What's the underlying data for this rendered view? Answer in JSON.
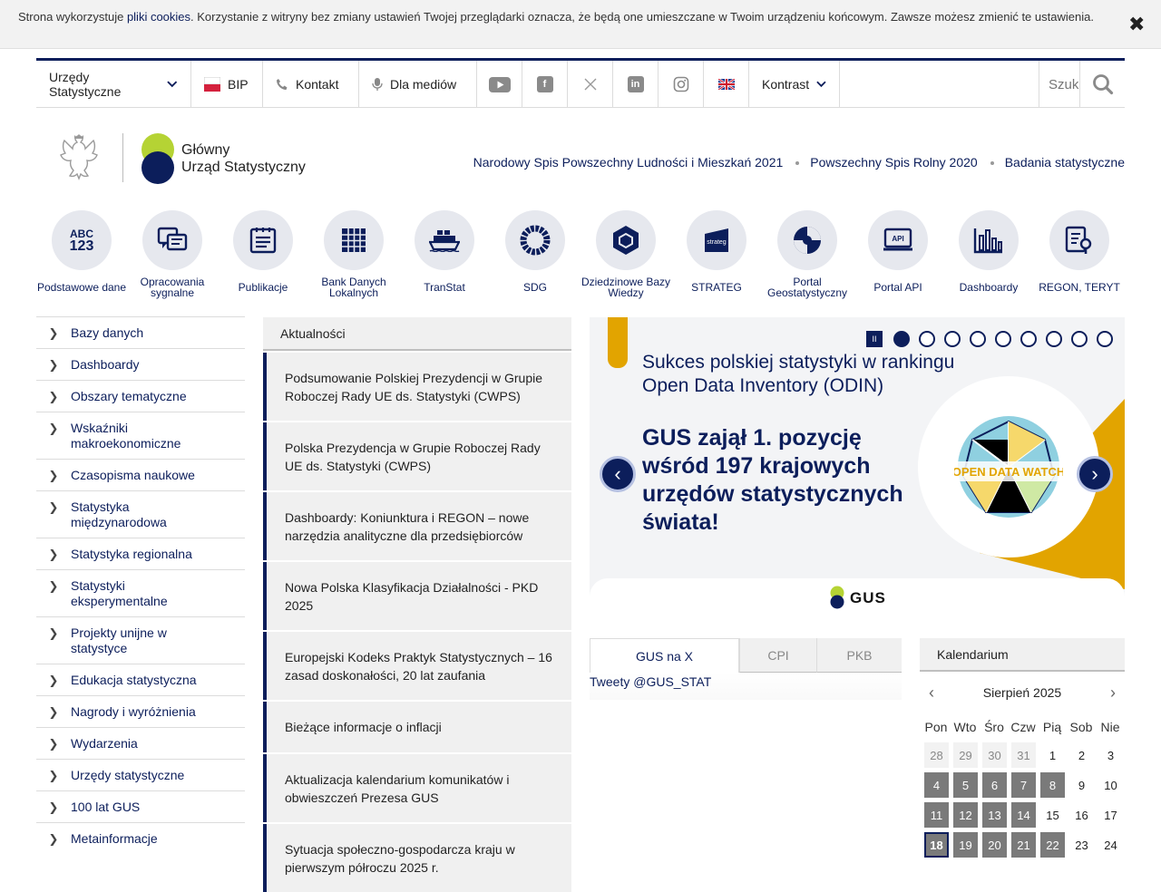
{
  "cookie": {
    "text_before": "Strona wykorzystuje ",
    "link": "pliki cookies",
    "text_after": ". Korzystanie z witryny bez zmiany ustawień Twojej przeglądarki oznacza, że będą one umieszczane w Twoim urządzeniu końcowym. Zawsze możesz zmienić te ustawienia.",
    "close": "✖"
  },
  "topbar": {
    "offices": "Urzędy Statystyczne",
    "bip": "BIP",
    "contact": "Kontakt",
    "media": "Dla mediów",
    "contrast": "Kontrast",
    "search_placeholder": "Szukaj",
    "social_icons": [
      "youtube-icon",
      "facebook-icon",
      "x-icon",
      "linkedin-icon",
      "instagram-icon",
      "uk-flag-icon"
    ]
  },
  "logo": {
    "line1": "Główny",
    "line2": "Urząd Statystyczny"
  },
  "header_links": [
    "Narodowy Spis Powszechny Ludności i Mieszkań 2021",
    "Powszechny Spis Rolny 2020",
    "Badania statystyczne"
  ],
  "tiles": [
    {
      "label": "Podstawowe dane",
      "icon": "abc-123-icon",
      "icon_text": "ABC"
    },
    {
      "label": "Opracowania sygnalne",
      "icon": "document-chat-icon"
    },
    {
      "label": "Publikacje",
      "icon": "publication-icon"
    },
    {
      "label": "Bank Danych Lokalnych",
      "icon": "grid-icon"
    },
    {
      "label": "TranStat",
      "icon": "ship-icon"
    },
    {
      "label": "SDG",
      "icon": "sdg-ring-icon"
    },
    {
      "label": "Dziedzinowe Bazy Wiedzy",
      "icon": "cube-icon"
    },
    {
      "label": "STRATEG",
      "icon": "strateg-icon",
      "icon_text": "strateg"
    },
    {
      "label": "Portal Geostatystyczny",
      "icon": "geo-icon"
    },
    {
      "label": "Portal API",
      "icon": "api-icon",
      "icon_text": "API"
    },
    {
      "label": "Dashboardy",
      "icon": "bar-chart-icon"
    },
    {
      "label": "REGON, TERYT",
      "icon": "search-document-icon"
    }
  ],
  "tile_123": "123",
  "sidebar": [
    "Bazy danych",
    "Dashboardy",
    "Obszary tematyczne",
    "Wskaźniki makroekonomiczne",
    "Czasopisma naukowe",
    "Statystyka międzynarodowa",
    "Statystyka regionalna",
    "Statystyki eksperymentalne",
    "Projekty unijne w statystyce",
    "Edukacja statystyczna",
    "Nagrody i wyróżnienia",
    "Wydarzenia",
    "Urzędy statystyczne",
    "100 lat GUS",
    "Metainformacje"
  ],
  "news": {
    "header": "Aktualności",
    "items": [
      "Podsumowanie Polskiej Prezydencji w Grupie Roboczej Rady UE ds. Statystyki (CWPS)",
      "Polska Prezydencja w Grupie Roboczej Rady UE ds. Statystyki (CWPS)",
      "Dashboardy: Koniunktura i REGON – nowe narzędzia analityczne dla przedsiębiorców",
      "Nowa Polska Klasyfikacja Działalności - PKD 2025",
      "Europejski Kodeks Praktyk Statystycznych – 16 zasad doskonałości, 20 lat zaufania",
      "Bieżące informacje o inflacji",
      "Aktualizacja kalendarium komunikatów i obwieszczeń Prezesa GUS",
      "Sytuacja społeczno-gospodarcza kraju w pierwszym półroczu 2025 r."
    ]
  },
  "slider": {
    "pause": "II",
    "slide_count": 9,
    "active_slide": 1,
    "title": "Sukces polskiej statystyki w rankingu Open Data Inventory (ODIN)",
    "headline": "GUS zajął 1. pozycję wśród 197 krajowych urzędów statystycznych świata!",
    "badge": "OPEN DATA WATCH",
    "footer_logo": "GUS",
    "prev": "‹",
    "next": "›",
    "accent": "#e2a400"
  },
  "tabs": {
    "items": [
      "GUS na X",
      "CPI",
      "PKB"
    ],
    "active": "GUS na X",
    "tweets": "Tweety @GUS_STAT"
  },
  "calendar": {
    "header": "Kalendarium",
    "month": "Sierpień 2025",
    "prev": "‹",
    "next": "›",
    "day_names": [
      "Pon",
      "Wto",
      "Śro",
      "Czw",
      "Pią",
      "Sob",
      "Nie"
    ],
    "days": [
      {
        "n": "28",
        "s": "out"
      },
      {
        "n": "29",
        "s": "out"
      },
      {
        "n": "30",
        "s": "out"
      },
      {
        "n": "31",
        "s": "out"
      },
      {
        "n": "1",
        "s": "plain"
      },
      {
        "n": "2",
        "s": "plain"
      },
      {
        "n": "3",
        "s": "plain"
      },
      {
        "n": "4",
        "s": "g"
      },
      {
        "n": "5",
        "s": "g"
      },
      {
        "n": "6",
        "s": "g"
      },
      {
        "n": "7",
        "s": "g"
      },
      {
        "n": "8",
        "s": "g"
      },
      {
        "n": "9",
        "s": "plain"
      },
      {
        "n": "10",
        "s": "plain"
      },
      {
        "n": "11",
        "s": "g"
      },
      {
        "n": "12",
        "s": "g"
      },
      {
        "n": "13",
        "s": "g"
      },
      {
        "n": "14",
        "s": "g"
      },
      {
        "n": "15",
        "s": "plain"
      },
      {
        "n": "16",
        "s": "plain"
      },
      {
        "n": "17",
        "s": "plain"
      },
      {
        "n": "18",
        "s": "today"
      },
      {
        "n": "19",
        "s": "g"
      },
      {
        "n": "20",
        "s": "g"
      },
      {
        "n": "21",
        "s": "g"
      },
      {
        "n": "22",
        "s": "g"
      },
      {
        "n": "23",
        "s": "plain"
      },
      {
        "n": "24",
        "s": "plain"
      }
    ]
  },
  "colors": {
    "brand_navy": "#0c1e5b",
    "brand_lime": "#b5d334",
    "accent_yellow": "#e2a400"
  }
}
